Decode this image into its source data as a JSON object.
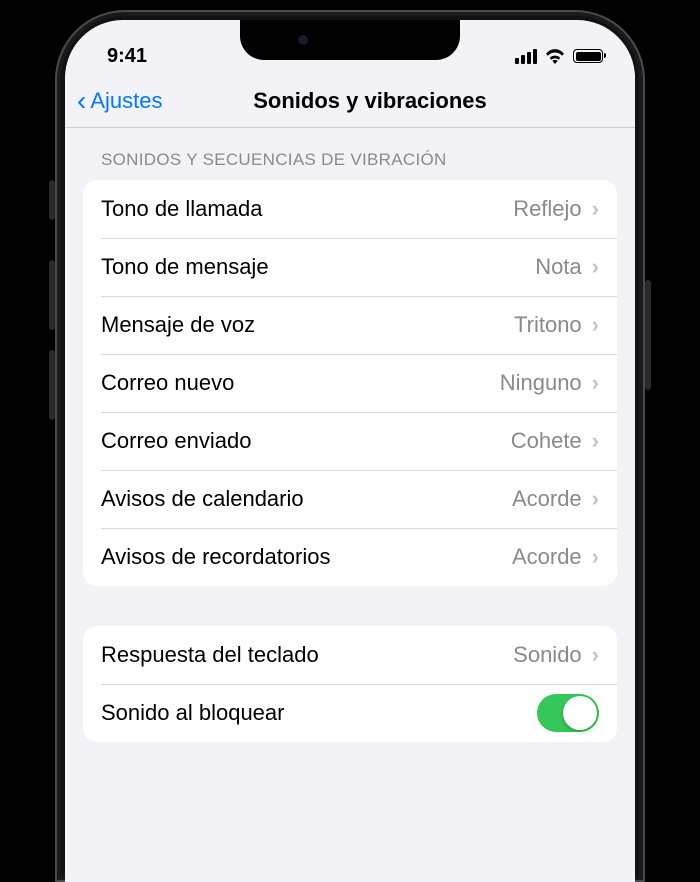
{
  "status": {
    "time": "9:41"
  },
  "nav": {
    "back": "Ajustes",
    "title": "Sonidos y vibraciones"
  },
  "section1": {
    "header": "SONIDOS Y SECUENCIAS DE VIBRACIÓN",
    "rows": [
      {
        "label": "Tono de llamada",
        "value": "Reflejo"
      },
      {
        "label": "Tono de mensaje",
        "value": "Nota"
      },
      {
        "label": "Mensaje de voz",
        "value": "Tritono"
      },
      {
        "label": "Correo nuevo",
        "value": "Ninguno"
      },
      {
        "label": "Correo enviado",
        "value": "Cohete"
      },
      {
        "label": "Avisos de calendario",
        "value": "Acorde"
      },
      {
        "label": "Avisos de recordatorios",
        "value": "Acorde"
      }
    ]
  },
  "section2": {
    "rows": [
      {
        "label": "Respuesta del teclado",
        "value": "Sonido",
        "type": "disclosure"
      },
      {
        "label": "Sonido al bloquear",
        "type": "toggle",
        "enabled": true
      }
    ]
  }
}
